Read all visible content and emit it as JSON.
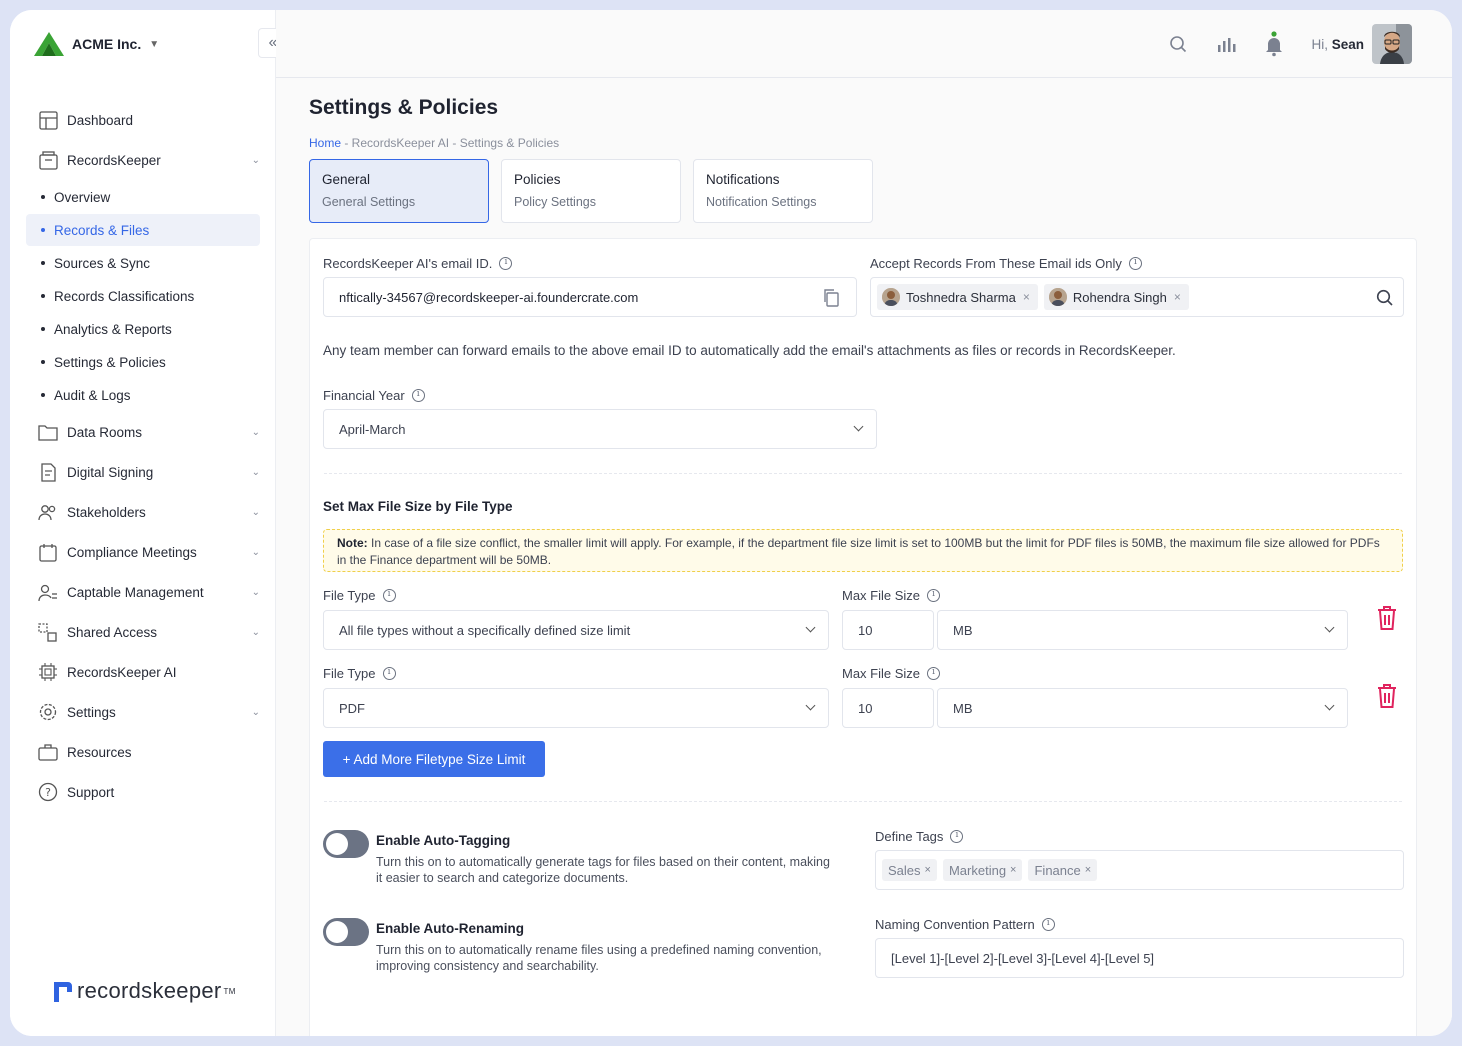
{
  "company": {
    "name": "ACME Inc."
  },
  "sidebar": {
    "items": [
      {
        "label": "Dashboard"
      },
      {
        "label": "RecordsKeeper"
      },
      {
        "label": "Overview"
      },
      {
        "label": "Records & Files"
      },
      {
        "label": "Sources & Sync"
      },
      {
        "label": "Records Classifications"
      },
      {
        "label": "Analytics & Reports"
      },
      {
        "label": "Settings & Policies"
      },
      {
        "label": "Audit & Logs"
      },
      {
        "label": "Data Rooms"
      },
      {
        "label": "Digital Signing"
      },
      {
        "label": "Stakeholders"
      },
      {
        "label": "Compliance Meetings"
      },
      {
        "label": "Captable Management"
      },
      {
        "label": "Shared Access"
      },
      {
        "label": "RecordsKeeper AI"
      },
      {
        "label": "Settings"
      },
      {
        "label": "Resources"
      },
      {
        "label": "Support"
      }
    ],
    "footer_logo": "recordskeeper",
    "footer_tm": "TM"
  },
  "header": {
    "greeting": "Hi,",
    "user": "Sean"
  },
  "page": {
    "title": "Settings & Policies",
    "breadcrumb_home": "Home",
    "breadcrumb_rest": " - RecordsKeeper AI - Settings & Policies"
  },
  "tabs": [
    {
      "title": "General",
      "subtitle": "General Settings"
    },
    {
      "title": "Policies",
      "subtitle": "Policy Settings"
    },
    {
      "title": "Notifications",
      "subtitle": "Notification Settings"
    }
  ],
  "general": {
    "email_label": "RecordsKeeper AI's email ID.",
    "email_value": "nftically-34567@recordskeeper-ai.foundercrate.com",
    "accept_label": "Accept Records From These Email ids Only",
    "accept_chips": [
      "Toshnedra Sharma",
      "Rohendra Singh"
    ],
    "forward_desc": "Any team member can forward emails to the above email ID to automatically add the email's attachments as files or records in RecordsKeeper.",
    "fy_label": "Financial Year",
    "fy_value": "April-March",
    "maxsize_title": "Set Max File Size by File Type",
    "note_bold": "Note:",
    "note_text": " In case of a file size conflict, the smaller limit will apply. For example, if the department file size limit is set to 100MB but the limit for PDF files is 50MB, the maximum file size allowed for PDFs in the Finance department will be 50MB.",
    "filetype_label": "File Type",
    "maxfile_label": "Max File Size",
    "rows": [
      {
        "type": "All file types without a specifically defined size limit",
        "size": "10",
        "unit": "MB"
      },
      {
        "type": "PDF",
        "size": "10",
        "unit": "MB"
      }
    ],
    "add_button": "+ Add More Filetype Size Limit",
    "autotag_title": "Enable Auto-Tagging",
    "autotag_desc": "Turn this on to automatically generate tags for files based on their content, making it easier to search and categorize documents.",
    "autotag_enabled": false,
    "define_tags_label": "Define Tags",
    "tags": [
      "Sales",
      "Marketing",
      "Finance"
    ],
    "autorename_title": "Enable Auto-Renaming",
    "autorename_desc": "Turn this on to automatically rename files using a predefined naming convention, improving consistency and searchability.",
    "autorename_enabled": false,
    "naming_label": "Naming Convention Pattern",
    "naming_value": "[Level 1]-[Level 2]-[Level 3]-[Level 4]-[Level 5]"
  },
  "colors": {
    "accent": "#3567e6",
    "active_tab_bg": "#e7ecf8",
    "delete": "#e0245e",
    "note_bg": "#fffbe9",
    "note_border": "#f0cf4a"
  }
}
